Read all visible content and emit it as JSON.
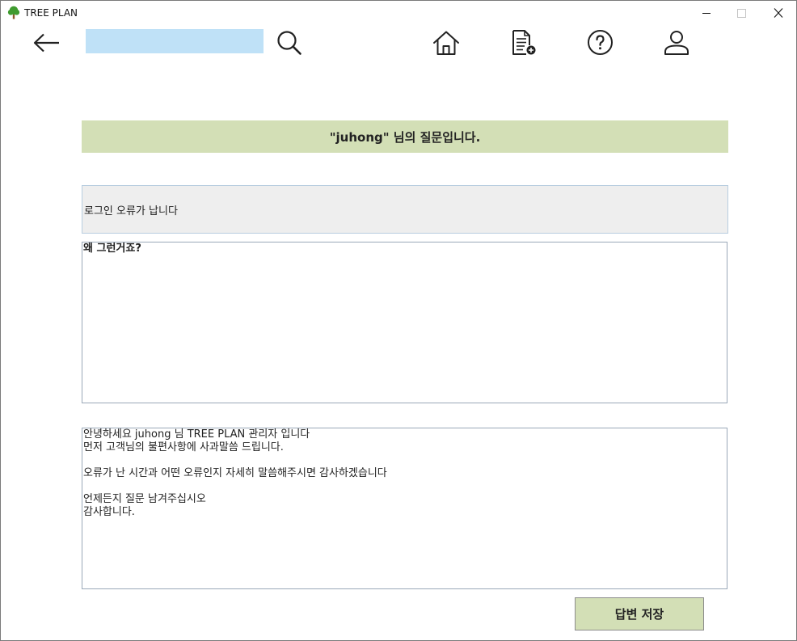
{
  "window": {
    "title": "TREE PLAN"
  },
  "toolbar": {
    "icons": {
      "app": "tree-icon",
      "back": "back-arrow-icon",
      "search": "search-icon",
      "home": "home-icon",
      "new_document": "document-add-icon",
      "help": "help-icon",
      "user": "user-icon"
    }
  },
  "question": {
    "header": "\"juhong\" 님의 질문입니다.",
    "title": "로그인 오류가 납니다",
    "body": "왜 그런거죠?"
  },
  "answer": {
    "body": "안녕하세요 juhong 님 TREE PLAN 관리자 입니다\n먼저 고객님의 불편사항에 사과말씀 드립니다.\n\n오류가 난 시간과 어떤 오류인지 자세히 말씀해주시면 감사하겠습니다\n\n언제든지 질문 남겨주십시오\n감사합니다."
  },
  "buttons": {
    "save_answer": "답변 저장"
  },
  "colors": {
    "accent": "#d3dfb6",
    "search_field": "#bfe1f7",
    "title_box": "#eeeeee"
  }
}
